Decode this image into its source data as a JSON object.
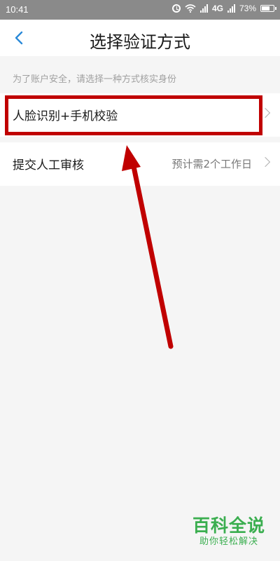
{
  "status_bar": {
    "time": "10:41",
    "network": "4G",
    "battery": "73%",
    "battery_level": 0.73
  },
  "header": {
    "title": "选择验证方式"
  },
  "hint": "为了账户安全，请选择一种方式核实身份",
  "options": [
    {
      "label": "人脸识别+手机校验",
      "detail": ""
    },
    {
      "label": "提交人工审核",
      "detail": "预计需2个工作日"
    }
  ],
  "annotation": {
    "color": "#c00000"
  },
  "watermark": {
    "title": "百科全说",
    "subtitle": "助你轻松解决"
  },
  "colors": {
    "status_bar": "#8a8a8a",
    "accent": "#2b8ad8",
    "background": "#f5f5f5",
    "watermark": "#3aae4f"
  }
}
